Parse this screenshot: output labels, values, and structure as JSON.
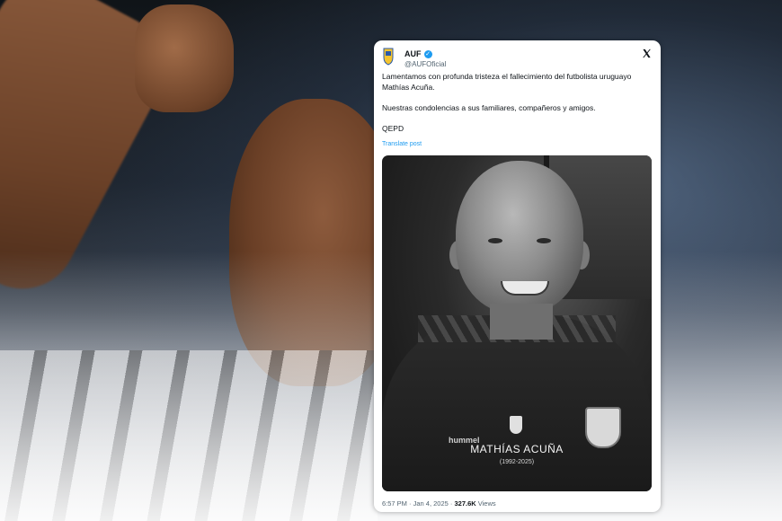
{
  "tweet": {
    "account_name": "AUF",
    "handle": "@AUFOficial",
    "text_line1": "Lamentamos con profunda tristeza el fallecimiento del futbolista uruguayo Mathías Acuña.",
    "text_line2": "Nuestras condolencias a sus familiares, compañeros y amigos.",
    "text_line3": "QEPD",
    "translate_label": "Translate post",
    "time": "6:57 PM · Jan 4, 2025 ·",
    "views_count": "327.6K",
    "views_label": "Views"
  },
  "media": {
    "memorial_name": "MATHÍAS ACUÑA",
    "memorial_years": "(1992-2025)",
    "shirt_brand": "hummel"
  },
  "colors": {
    "link": "#1d9bf0",
    "verified": "#1d9bf0",
    "text": "#0f1419",
    "muted": "#536471"
  },
  "icons": {
    "verified": "verified-badge-icon",
    "x_logo": "x-logo-icon",
    "account_logo": "auf-crest-icon"
  }
}
